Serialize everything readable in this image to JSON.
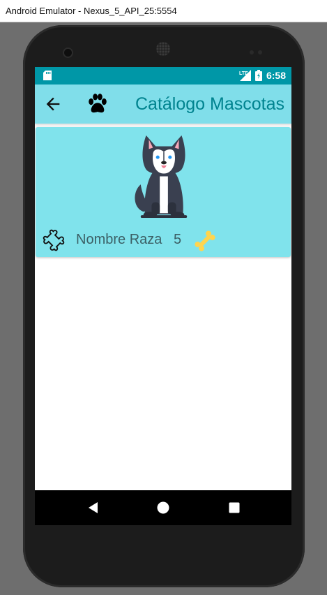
{
  "window": {
    "title": "Android Emulator - Nexus_5_API_25:5554"
  },
  "status_bar": {
    "time": "6:58",
    "icons": [
      "sd-card-icon",
      "lte-signal-icon",
      "battery-icon"
    ]
  },
  "app_bar": {
    "title": "Catálogo Mascotas",
    "back_icon": "arrow-back-icon",
    "logo_icon": "paw-icon"
  },
  "cards": [
    {
      "image_icon": "husky-dog-icon",
      "name": "Nombre Raza",
      "rating": "5",
      "left_icon": "bone-outline-icon",
      "right_icon": "bone-yellow-icon"
    }
  ],
  "nav_bar": {
    "icons": [
      "back-triangle-icon",
      "home-circle-icon",
      "recents-square-icon"
    ]
  },
  "colors": {
    "status_bar": "#0097a7",
    "app_bar": "#80deea",
    "title": "#00838f",
    "card": "#80e3ec",
    "bone_yellow": "#ffd54f"
  }
}
